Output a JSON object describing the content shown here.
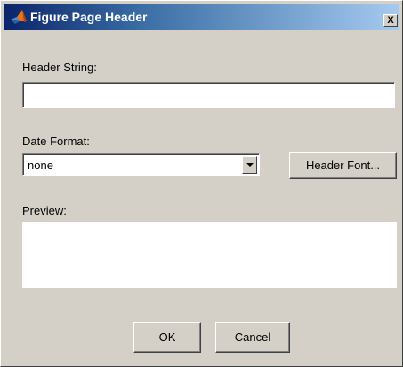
{
  "window": {
    "title": "Figure Page Header",
    "close_label": "X",
    "title_icon": "matlab-logo-icon",
    "colors": {
      "titlebar_start": "#0a246a",
      "titlebar_end": "#a6caf0",
      "face": "#d4d0c8"
    }
  },
  "header_string": {
    "label": "Header String:",
    "value": ""
  },
  "date_format": {
    "label": "Date Format:",
    "selected": "none"
  },
  "header_font_button": {
    "label": "Header Font..."
  },
  "preview": {
    "label": "Preview:",
    "content": ""
  },
  "buttons": {
    "ok": "OK",
    "cancel": "Cancel"
  }
}
